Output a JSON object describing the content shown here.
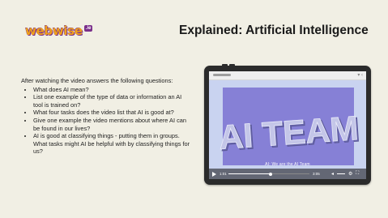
{
  "logo": {
    "text": "webwise",
    "badge": ".ie"
  },
  "title": "Explained: Artificial Intelligence",
  "instructions": {
    "intro": "After watching the video answers the following questions:",
    "questions": [
      "What does AI mean?",
      "List one example of the type of data or information an AI tool is trained on?",
      "What four tasks does the video list that AI is good at?",
      "Give one example the video mentions about where AI can be found in our lives?",
      "AI is good at classifying things - putting them in groups. What tasks might AI be helpful with by classifying things for us?"
    ]
  },
  "video": {
    "headline": "AI TEAM",
    "caption": "AI: We are the AI Team",
    "time_current": "1:01",
    "time_total": "3:05",
    "progress_percent": 52,
    "icons": {
      "play": "play-icon",
      "volume": "volume-icon",
      "settings": "settings-icon",
      "fullscreen": "fullscreen-icon",
      "browser": "wifi-battery-icon"
    }
  },
  "colors": {
    "background": "#f1efe4",
    "logo_orange": "#f0a11a",
    "logo_purple": "#7a2f8a",
    "video_bg": "#c9d3f0",
    "video_panel": "#8680d6",
    "headline_text": "#c4c6e8"
  }
}
